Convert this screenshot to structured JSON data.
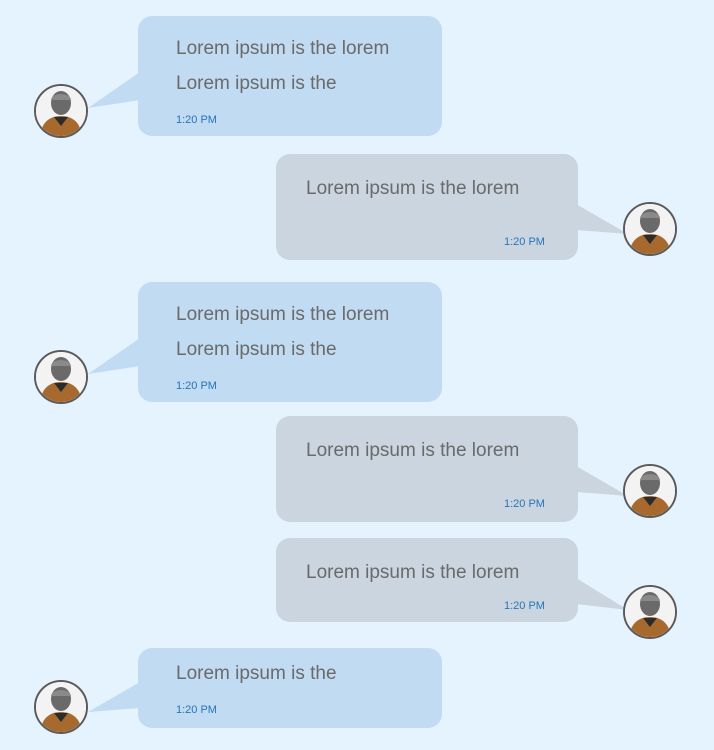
{
  "messages": [
    {
      "side": "incoming",
      "lines": [
        "Lorem ipsum is the lorem",
        "Lorem ipsum is the"
      ],
      "time": "1:20 PM"
    },
    {
      "side": "outgoing",
      "lines": [
        "Lorem ipsum is the lorem"
      ],
      "time": "1:20 PM"
    },
    {
      "side": "incoming",
      "lines": [
        "Lorem ipsum is the lorem",
        "Lorem ipsum is the"
      ],
      "time": "1:20 PM"
    },
    {
      "side": "outgoing",
      "lines": [
        "Lorem ipsum is the lorem"
      ],
      "time": "1:20 PM"
    },
    {
      "side": "outgoing",
      "lines": [
        "Lorem ipsum is the lorem"
      ],
      "time": "1:20 PM"
    },
    {
      "side": "incoming",
      "lines": [
        "Lorem ipsum is the"
      ],
      "time": "1:20 PM"
    }
  ],
  "colors": {
    "background": "#e5f3fe",
    "incoming_bubble": "#c1dbf2",
    "outgoing_bubble": "#cad5df",
    "message_text": "#6a6a6a",
    "timestamp": "#2874b8"
  },
  "avatar_icon": "user-avatar-icon"
}
